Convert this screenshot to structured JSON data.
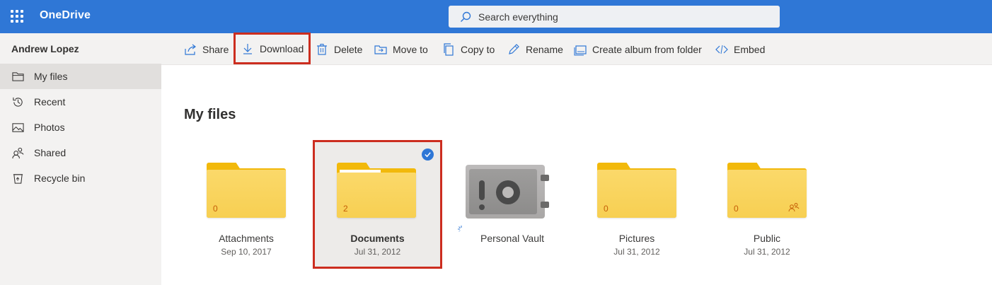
{
  "app": {
    "title": "OneDrive"
  },
  "search": {
    "placeholder": "Search everything"
  },
  "user": {
    "name": "Andrew Lopez"
  },
  "commands": [
    {
      "label": "Share",
      "icon": "share-icon"
    },
    {
      "label": "Download",
      "icon": "download-icon"
    },
    {
      "label": "Delete",
      "icon": "trash-icon"
    },
    {
      "label": "Move to",
      "icon": "move-icon"
    },
    {
      "label": "Copy to",
      "icon": "copy-icon"
    },
    {
      "label": "Rename",
      "icon": "pencil-icon"
    },
    {
      "label": "Create album from folder",
      "icon": "album-icon"
    },
    {
      "label": "Embed",
      "icon": "code-icon"
    }
  ],
  "nav": [
    {
      "label": "My files",
      "icon": "folder-icon",
      "active": true
    },
    {
      "label": "Recent",
      "icon": "clock-icon"
    },
    {
      "label": "Photos",
      "icon": "image-icon"
    },
    {
      "label": "Shared",
      "icon": "people-icon"
    },
    {
      "label": "Recycle bin",
      "icon": "recycle-bin-icon"
    }
  ],
  "main": {
    "title": "My files"
  },
  "tiles": [
    {
      "name": "Attachments",
      "date": "Sep 10, 2017",
      "count": "0"
    },
    {
      "name": "Documents",
      "date": "Jul 31, 2012",
      "count": "2",
      "selected": true
    },
    {
      "name": "Personal Vault",
      "date": ""
    },
    {
      "name": "Pictures",
      "date": "Jul 31, 2012",
      "count": "0"
    },
    {
      "name": "Public",
      "date": "Jul 31, 2012",
      "count": "0",
      "shared": true
    }
  ],
  "colors": {
    "brand": "#2f77d6",
    "highlight": "#cc2d1f",
    "folder": "#f7cf52"
  }
}
